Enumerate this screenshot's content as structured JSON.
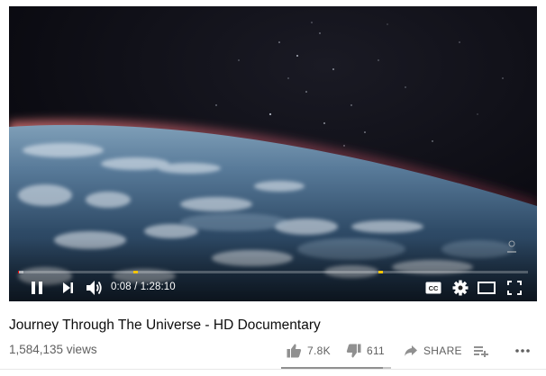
{
  "player": {
    "time_current": "0:08",
    "time_separator": "/",
    "time_total": "1:28:10",
    "progress_played_fraction": 0.002,
    "progress_buffered_fraction": 0.01,
    "chapter_marker_fractions": [
      0.227,
      0.707
    ],
    "accent_color": "#ff0000",
    "marker_color": "#f5c400",
    "controls": {
      "pause_icon": "pause-icon",
      "next_icon": "next-icon",
      "volume_icon": "volume-icon",
      "subtitles_icon": "cc-icon",
      "settings_icon": "gear-icon",
      "theater_icon": "theater-mode-icon",
      "fullscreen_icon": "fullscreen-icon"
    },
    "watermark_icon": "channel-watermark-icon"
  },
  "video": {
    "title": "Journey Through The Universe - HD Documentary",
    "views": "1,584,135 views",
    "like_ratio": 0.927
  },
  "actions": {
    "like_count": "7.8K",
    "dislike_count": "611",
    "share_label": "SHARE",
    "like_icon": "thumbs-up-icon",
    "dislike_icon": "thumbs-down-icon",
    "share_icon": "share-arrow-icon",
    "save_icon": "add-to-playlist-icon",
    "more_icon": "more-horizontal-icon"
  }
}
